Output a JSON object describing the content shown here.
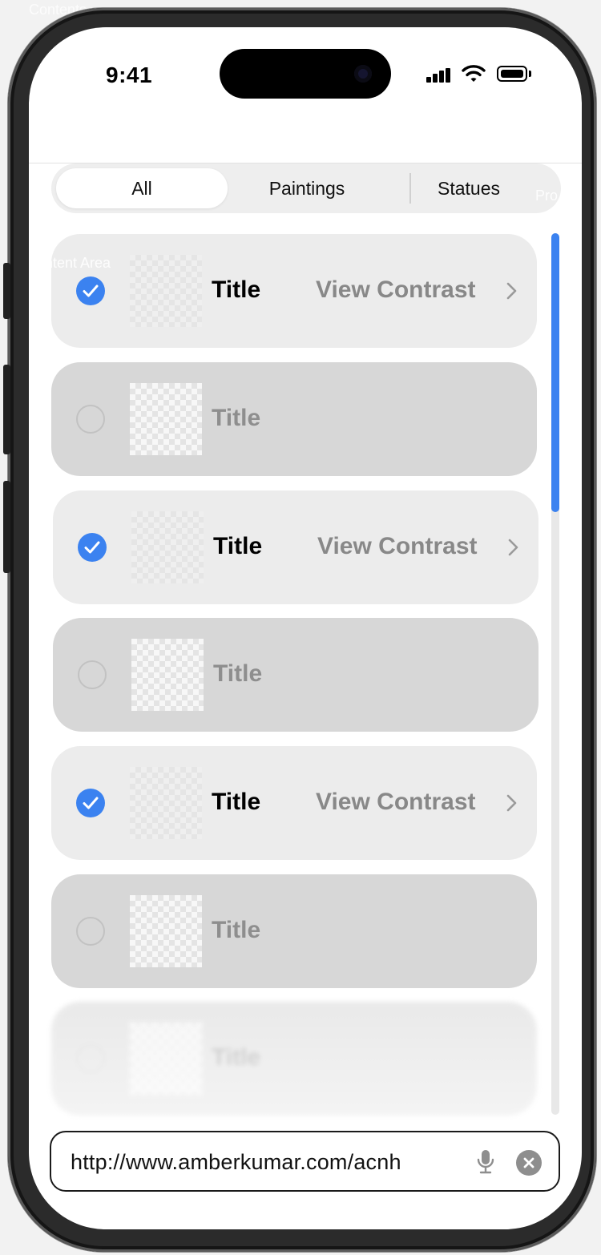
{
  "overlay": {
    "contents_label": "Contents",
    "properties_label": "Pro",
    "content_area_label": "ntent Area"
  },
  "status_bar": {
    "time": "9:41"
  },
  "segmented_control": {
    "segments": [
      {
        "label": "All",
        "selected": true
      },
      {
        "label": "Paintings",
        "selected": false
      },
      {
        "label": "Statues",
        "selected": false
      }
    ]
  },
  "list": {
    "rows": [
      {
        "title": "Title",
        "checked": true,
        "action": "View Contrast"
      },
      {
        "title": "Title",
        "checked": false
      },
      {
        "title": "Title",
        "checked": true,
        "action": "View Contrast"
      },
      {
        "title": "Title",
        "checked": false
      },
      {
        "title": "Title",
        "checked": true,
        "action": "View Contrast"
      },
      {
        "title": "Title",
        "checked": false
      },
      {
        "title": "Title",
        "checked": false
      }
    ]
  },
  "scrollbar": {
    "visible_fraction": 0.32,
    "position_fraction": 0.0
  },
  "url_bar": {
    "url": "http://www.amberkumar.com/acnh"
  },
  "colors": {
    "accent": "#3b82f0",
    "selected_row_bg": "#ececec",
    "unselected_row_bg": "#d7d7d7"
  },
  "icons": [
    "signal-icon",
    "wifi-icon",
    "battery-icon",
    "checkmark-icon",
    "chevron-right-icon",
    "microphone-icon",
    "clear-icon"
  ]
}
